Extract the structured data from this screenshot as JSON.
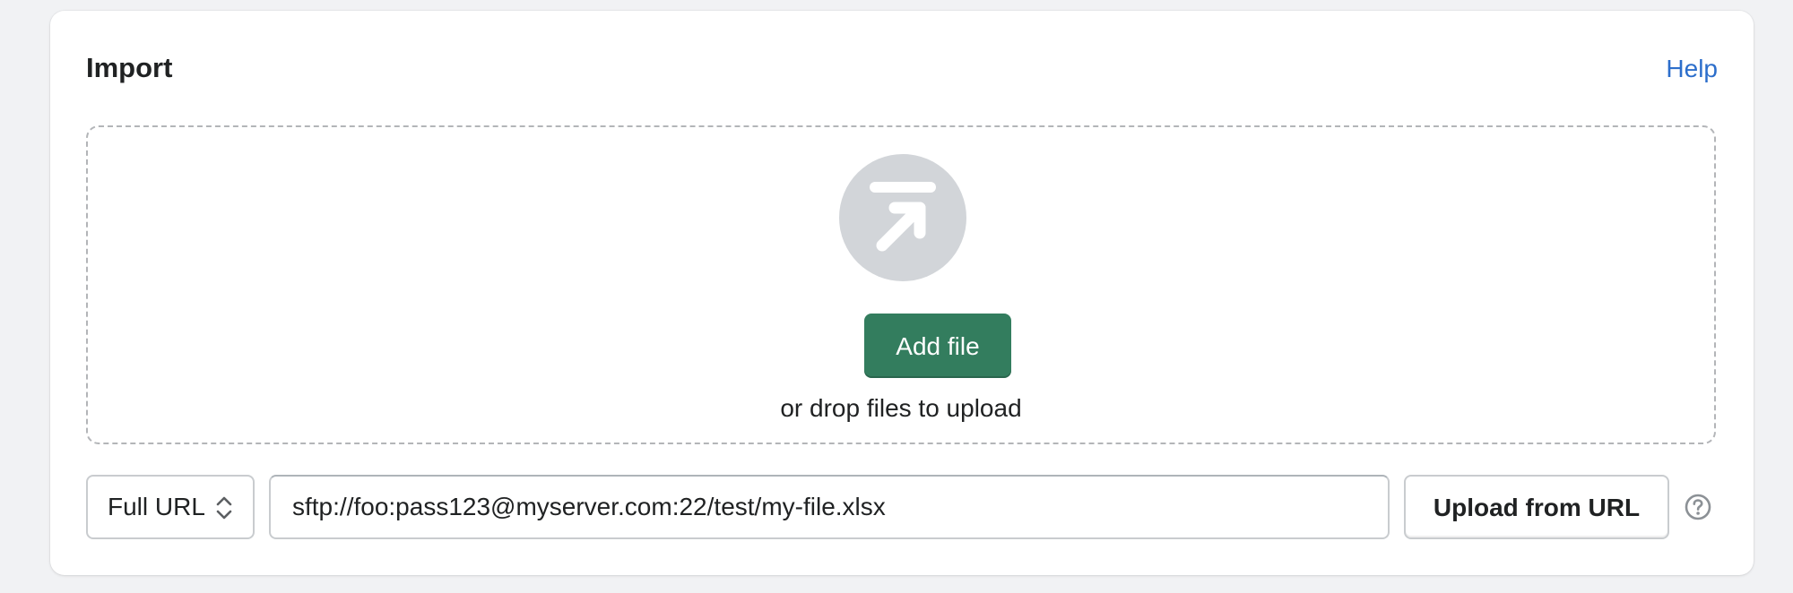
{
  "card": {
    "title": "Import",
    "help_link": "Help"
  },
  "dropzone": {
    "icon": "upload-arrow-icon",
    "add_file_label": "Add file",
    "drop_hint": "or drop files to upload"
  },
  "url_import": {
    "mode_select": {
      "selected": "Full URL",
      "icon": "chevron-up-down-icon"
    },
    "url_value": "sftp://foo:pass123@myserver.com:22/test/my-file.xlsx",
    "upload_button_label": "Upload from URL",
    "help_icon": "question-circle-icon"
  },
  "colors": {
    "page_background": "#f1f2f4",
    "card_background": "#ffffff",
    "primary_button": "#337d5e",
    "link": "#2c6ecb",
    "icon_circle": "#d2d5d9",
    "border": "#c9cccf"
  }
}
